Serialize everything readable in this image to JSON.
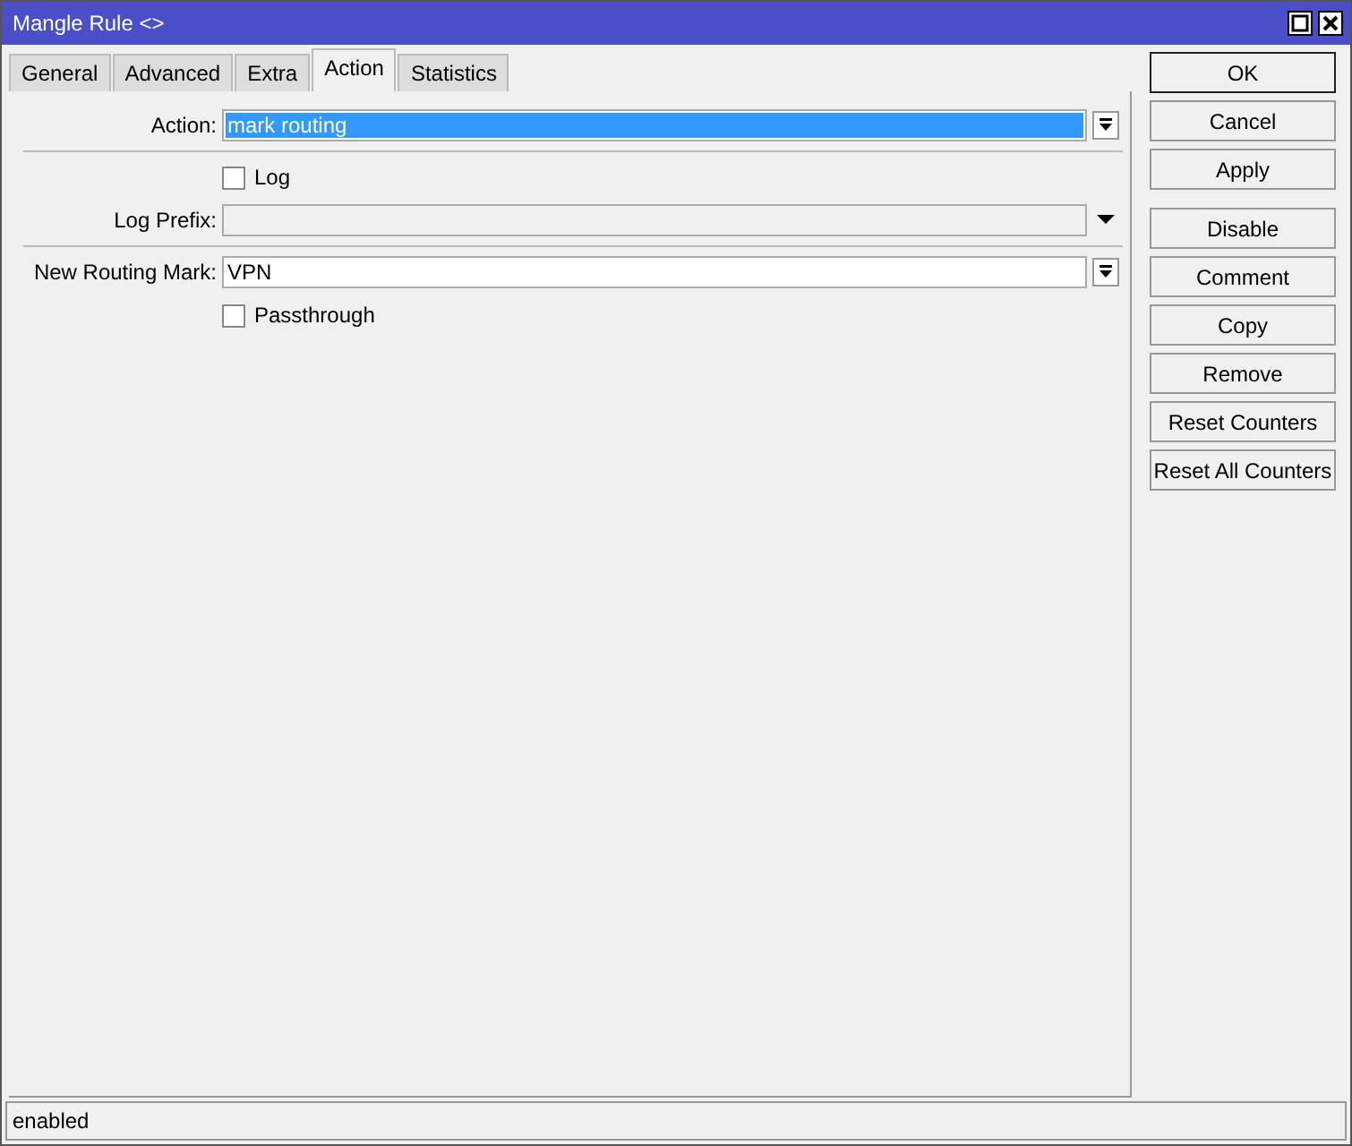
{
  "window": {
    "title": "Mangle Rule <>"
  },
  "tabs": [
    {
      "label": "General",
      "selected": false
    },
    {
      "label": "Advanced",
      "selected": false
    },
    {
      "label": "Extra",
      "selected": false
    },
    {
      "label": "Action",
      "selected": true
    },
    {
      "label": "Statistics",
      "selected": false
    }
  ],
  "rows": [
    {
      "kind": "select",
      "label": "Action:",
      "value": "mark routing",
      "highlighted": true
    },
    {
      "kind": "separator"
    },
    {
      "kind": "checkbox",
      "label": "Log",
      "checked": false
    },
    {
      "kind": "combo",
      "label": "Log Prefix:"
    },
    {
      "kind": "separator"
    },
    {
      "kind": "select",
      "label": "New Routing Mark:",
      "value": "VPN",
      "highlighted": false
    },
    {
      "kind": "checkbox",
      "label": "Passthrough",
      "checked": false
    }
  ],
  "button_groups": [
    [
      {
        "label": "OK",
        "default": true
      },
      {
        "label": "Cancel",
        "default": false
      },
      {
        "label": "Apply",
        "default": false
      }
    ],
    [
      {
        "label": "Disable",
        "default": false
      },
      {
        "label": "Comment",
        "default": false
      },
      {
        "label": "Copy",
        "default": false
      },
      {
        "label": "Remove",
        "default": false
      },
      {
        "label": "Reset Counters",
        "default": false
      },
      {
        "label": "Reset All Counters",
        "default": false
      }
    ]
  ],
  "status_bar": {
    "text": "enabled"
  }
}
